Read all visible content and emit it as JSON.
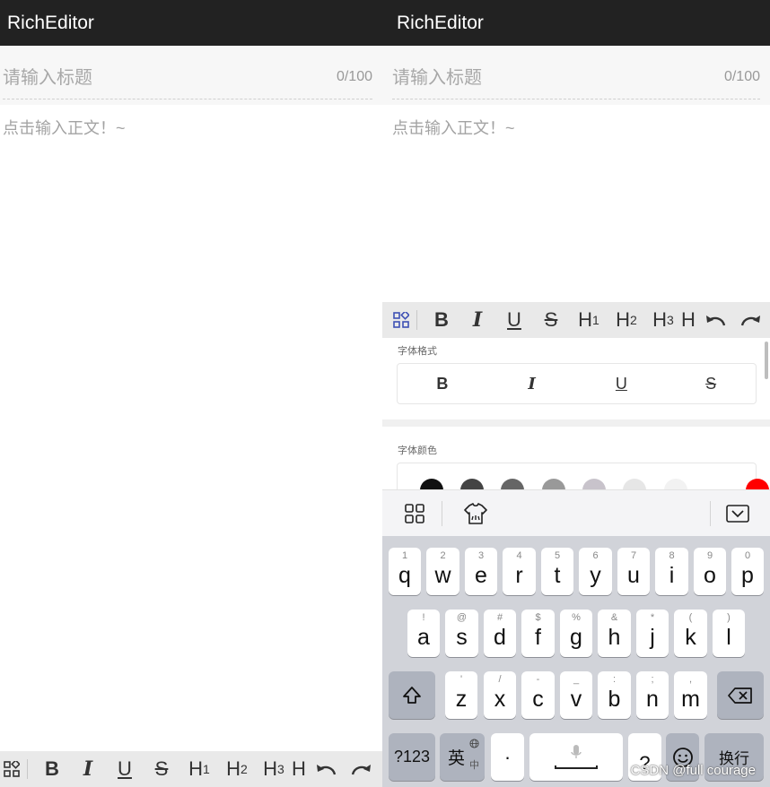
{
  "app": {
    "title": "RichEditor"
  },
  "editor": {
    "title_placeholder": "请输入标题",
    "title_count": "0/100",
    "body_placeholder": "点击输入正文！~"
  },
  "toolbar": {
    "bold": "B",
    "italic": "I",
    "underline": "U",
    "strike": "S",
    "h1_letter": "H",
    "h1_num": "1",
    "h2_letter": "H",
    "h2_num": "2",
    "h3_letter": "H",
    "h3_num": "3",
    "h4_letter": "H",
    "icons": [
      "grid-icon",
      "undo-icon",
      "redo-icon"
    ]
  },
  "format_panel": {
    "font_format_label": "字体格式",
    "buttons": [
      "B",
      "I",
      "U",
      "S"
    ],
    "font_color_label": "字体颜色",
    "colors": [
      "#111111",
      "#444444",
      "#666666",
      "#999999",
      "#c8c3cb",
      "#e6e6e6",
      "#f2f2f2",
      "#ff0000"
    ]
  },
  "keyboard": {
    "top_icons": [
      "grid-icon",
      "skin-icon",
      "collapse-keyboard-icon"
    ],
    "row1": [
      {
        "key": "q",
        "sub": "1"
      },
      {
        "key": "w",
        "sub": "2"
      },
      {
        "key": "e",
        "sub": "3"
      },
      {
        "key": "r",
        "sub": "4"
      },
      {
        "key": "t",
        "sub": "5"
      },
      {
        "key": "y",
        "sub": "6"
      },
      {
        "key": "u",
        "sub": "7"
      },
      {
        "key": "i",
        "sub": "8"
      },
      {
        "key": "o",
        "sub": "9"
      },
      {
        "key": "p",
        "sub": "0"
      }
    ],
    "row2": [
      {
        "key": "a",
        "sub": "!"
      },
      {
        "key": "s",
        "sub": "@"
      },
      {
        "key": "d",
        "sub": "#"
      },
      {
        "key": "f",
        "sub": "$"
      },
      {
        "key": "g",
        "sub": "%"
      },
      {
        "key": "h",
        "sub": "&"
      },
      {
        "key": "j",
        "sub": "*"
      },
      {
        "key": "k",
        "sub": "("
      },
      {
        "key": "l",
        "sub": ")"
      }
    ],
    "row3": [
      {
        "key": "z",
        "sub": "'"
      },
      {
        "key": "x",
        "sub": "/"
      },
      {
        "key": "c",
        "sub": "-"
      },
      {
        "key": "v",
        "sub": "_"
      },
      {
        "key": "b",
        "sub": ":"
      },
      {
        "key": "n",
        "sub": ";"
      },
      {
        "key": "m",
        "sub": ","
      }
    ],
    "numbers_key": "?123",
    "lang_key": "英",
    "lang_key_sub": "中",
    "dot_key": "·",
    "question_key": "?",
    "enter_key": "换行"
  },
  "watermark": "CSDN @full courage"
}
